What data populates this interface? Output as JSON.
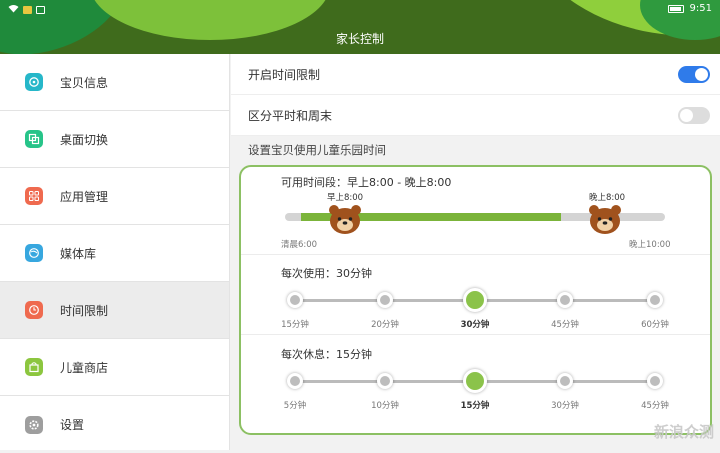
{
  "status_bar": {
    "time": "9:51"
  },
  "header": {
    "title": "家长控制"
  },
  "sidebar": {
    "items": [
      {
        "label": "宝贝信息",
        "icon": "baby-info-icon",
        "color": "#26b7c9"
      },
      {
        "label": "桌面切换",
        "icon": "desktop-switch-icon",
        "color": "#27c489"
      },
      {
        "label": "应用管理",
        "icon": "app-management-icon",
        "color": "#ef6a4f"
      },
      {
        "label": "媒体库",
        "icon": "media-library-icon",
        "color": "#37a7df"
      },
      {
        "label": "时间限制",
        "icon": "clock-icon",
        "color": "#ef6a4f",
        "active": true
      },
      {
        "label": "儿童商店",
        "icon": "shopping-bag-icon",
        "color": "#8cc63f"
      },
      {
        "label": "设置",
        "icon": "gear-icon",
        "color": "#9e9e9e"
      }
    ]
  },
  "settings": {
    "enable_time_limit": {
      "label": "开启时间限制",
      "on": true
    },
    "weekday_weekend": {
      "label": "区分平时和周末",
      "on": false
    },
    "section_title": "设置宝贝使用儿童乐园时间"
  },
  "time_range": {
    "title": "可用时间段：早上8:00 - 晚上8:00",
    "start_label": "早上8:00",
    "end_label": "晚上8:00",
    "min_label": "清晨6:00",
    "max_label": "晚上10:00"
  },
  "usage": {
    "title": "每次使用：30分钟",
    "options": [
      "15分钟",
      "20分钟",
      "30分钟",
      "45分钟",
      "60分钟"
    ],
    "selected_index": 2
  },
  "rest": {
    "title": "每次休息：15分钟",
    "options": [
      "5分钟",
      "10分钟",
      "15分钟",
      "30分钟",
      "45分钟"
    ],
    "selected_index": 2
  },
  "watermark": "新浪众测",
  "colors": {
    "accent_green": "#8bc34a",
    "toggle_blue": "#2f7bea",
    "header_green": "#3f6b1c"
  }
}
